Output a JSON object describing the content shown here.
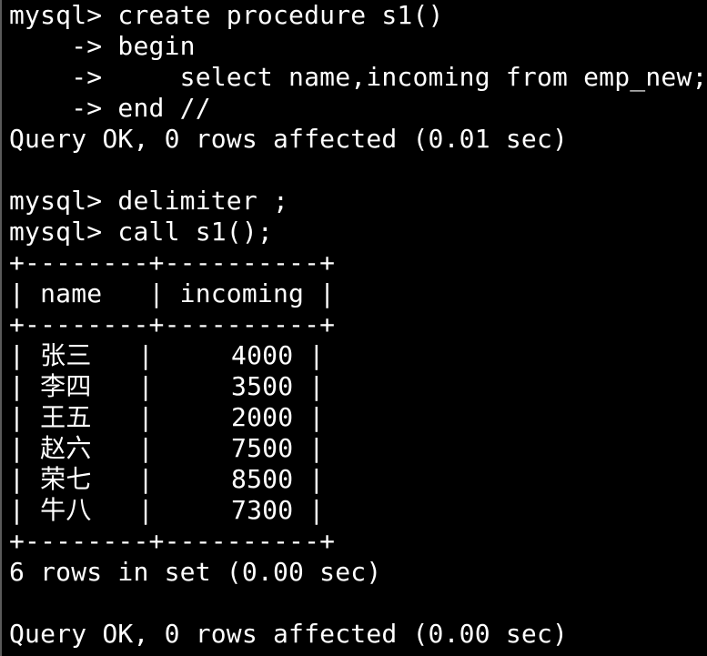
{
  "terminal": {
    "lines": [
      "mysql> create procedure s1()",
      "    -> begin",
      "    ->     select name,incoming from emp_new;",
      "    -> end //",
      "Query OK, 0 rows affected (0.01 sec)",
      "",
      "mysql> delimiter ;",
      "mysql> call s1();",
      "+--------+----------+",
      "| name   | incoming |",
      "+--------+----------+",
      "| 张三   |     4000 |",
      "| 李四   |     3500 |",
      "| 王五   |     2000 |",
      "| 赵六   |     7500 |",
      "| 荣七   |     8500 |",
      "| 牛八   |     7300 |",
      "+--------+----------+",
      "6 rows in set (0.00 sec)",
      "",
      "Query OK, 0 rows affected (0.00 sec)"
    ]
  }
}
